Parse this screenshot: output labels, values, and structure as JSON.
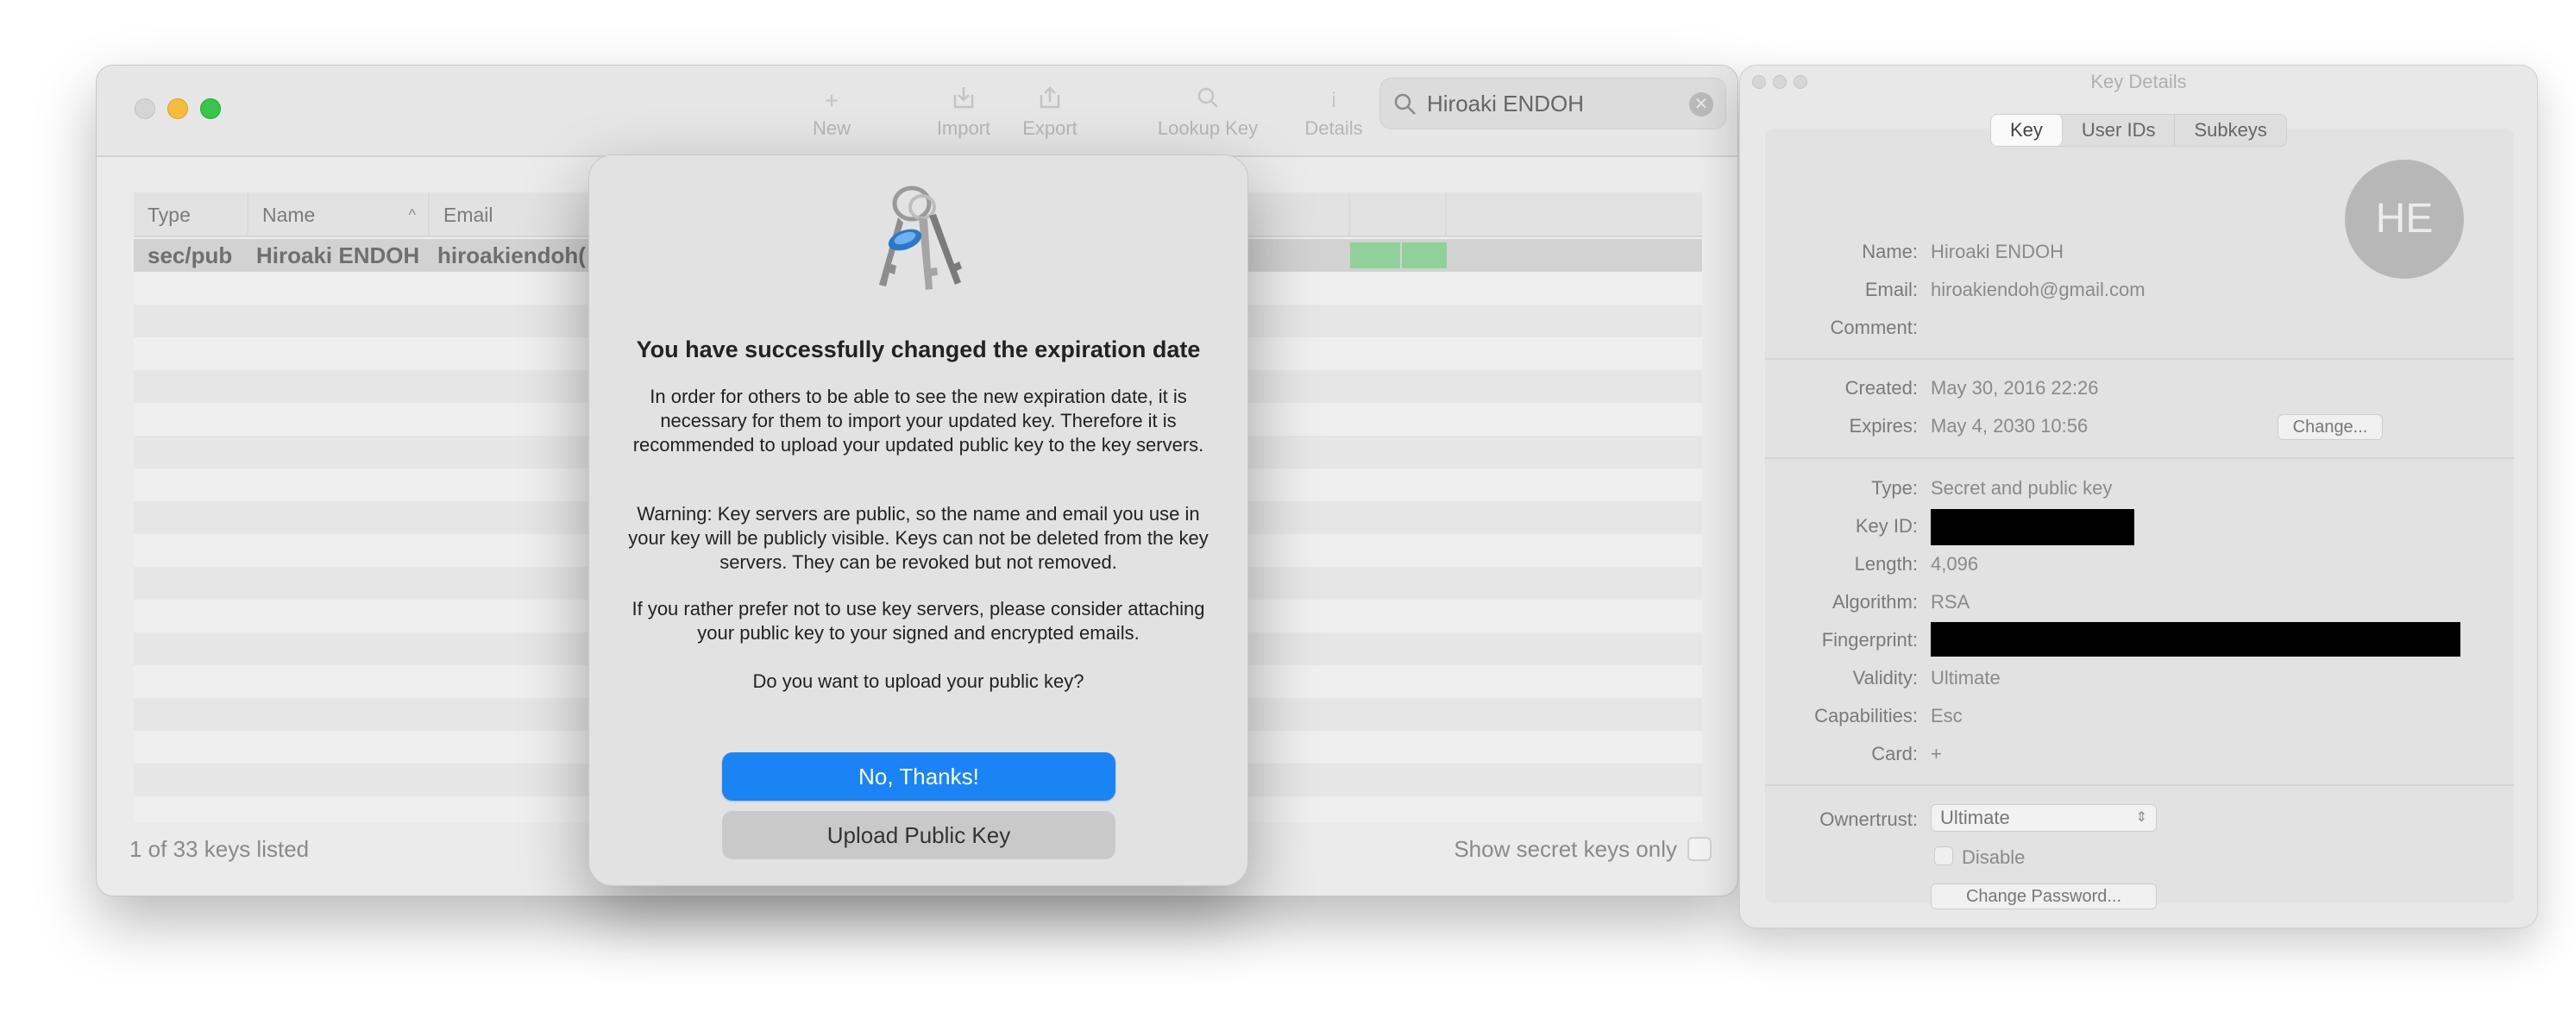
{
  "main_window": {
    "toolbar": {
      "new_label": "New",
      "import_label": "Import",
      "export_label": "Export",
      "lookup_label": "Lookup Key",
      "details_label": "Details"
    },
    "search": {
      "value": "Hiroaki ENDOH"
    },
    "table": {
      "headers": {
        "type": "Type",
        "name": "Name",
        "email": "Email"
      },
      "rows": [
        {
          "type": "sec/pub",
          "name": "Hiroaki ENDOH",
          "email": "hiroakiendoh("
        }
      ]
    },
    "footer": {
      "count": "1 of 33 keys listed",
      "secret_only": "Show secret keys only"
    }
  },
  "dialog": {
    "title": "You have successfully changed the expiration date",
    "paragraph1": "In order for others to be able to see the new expiration date, it is necessary for them to import your updated key. Therefore it is recommended to upload your updated public key to the key servers.",
    "paragraph2": "Warning: Key servers are public, so the name and email you use in your key will be publicly visible. Keys can not be deleted from the key servers. They can be revoked but not removed.",
    "paragraph3": "If you rather prefer not to use key servers, please consider attaching your public key to your signed and encrypted emails.",
    "question": "Do you want to upload your public key?",
    "primary_button": "No, Thanks!",
    "secondary_button": "Upload Public Key"
  },
  "details_window": {
    "title": "Key Details",
    "tabs": [
      "Key",
      "User IDs",
      "Subkeys"
    ],
    "avatar_initials": "HE",
    "labels": {
      "name": "Name:",
      "email": "Email:",
      "comment": "Comment:",
      "created": "Created:",
      "expires": "Expires:",
      "type": "Type:",
      "key_id": "Key ID:",
      "length": "Length:",
      "algorithm": "Algorithm:",
      "fingerprint": "Fingerprint:",
      "validity": "Validity:",
      "capabilities": "Capabilities:",
      "card": "Card:",
      "ownertrust": "Ownertrust:"
    },
    "values": {
      "name": "Hiroaki ENDOH",
      "email": "hiroakiendoh@gmail.com",
      "comment": "",
      "created": "May 30, 2016 22:26",
      "expires": "May 4, 2030 10:56",
      "type": "Secret and public key",
      "length": "4,096",
      "algorithm": "RSA",
      "validity": "Ultimate",
      "capabilities": "Esc",
      "card": "+",
      "ownertrust": "Ultimate"
    },
    "change_button": "Change...",
    "disable_label": "Disable",
    "change_password_button": "Change Password..."
  }
}
